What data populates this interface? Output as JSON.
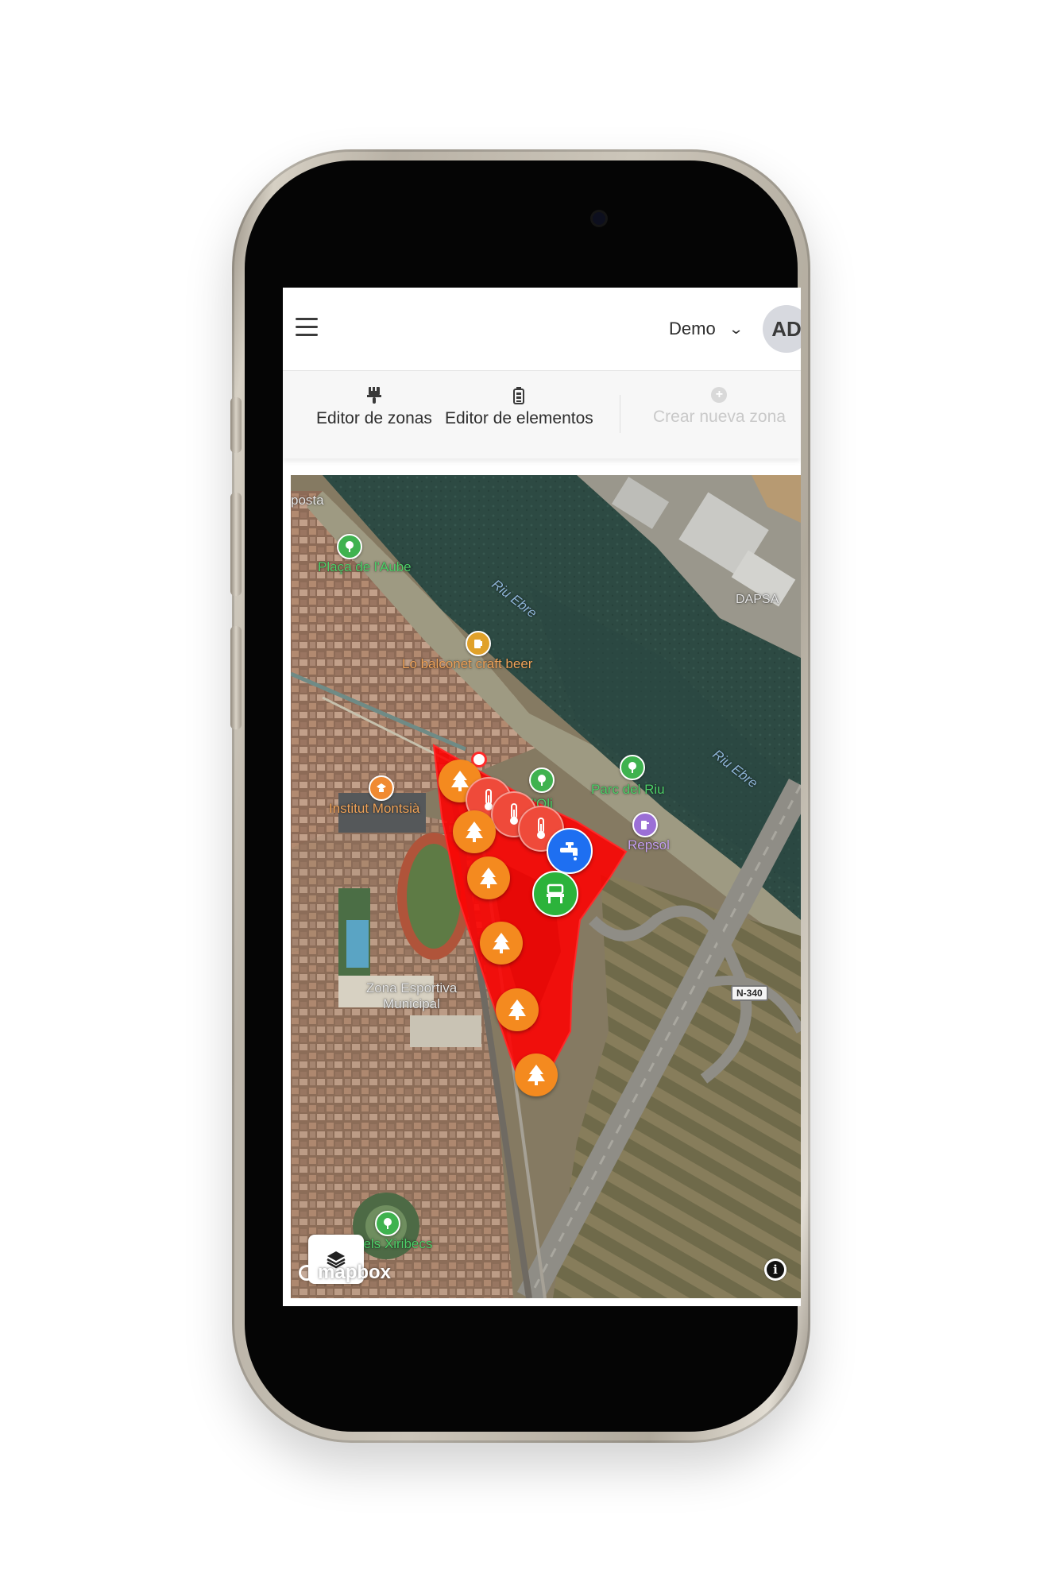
{
  "header": {
    "menu_icon": "hamburger-icon",
    "user_select_label": "Demo",
    "user_select_icon": "chevron-down-icon",
    "avatar_initials": "AD"
  },
  "toolbar": {
    "zone_editor_label": "Editor de zonas",
    "zone_editor_icon": "paint-brush-icon",
    "element_editor_label": "Editor de elementos",
    "element_editor_icon": "battery-icon",
    "create_zone_label": "Crear nueva zona",
    "create_zone_icon": "plus-circle-icon"
  },
  "map": {
    "labels": {
      "top_left_fragment": "posta",
      "placa": "Plaça de l'Aube",
      "river_1": "Riu Ebre",
      "river_2": "Riu Ebre",
      "dapsa": "DAPSA",
      "balconet": "Lo balconet craft beer",
      "parc_riu": "Parc del Riu",
      "oli": "l'Oli",
      "institut": "Institut Montsià",
      "repsol": "Repsol",
      "road_shield": "N-340",
      "zona_esportiva": "Zona Esportiva Municipal",
      "xiribecs": "dels Xiribecs"
    },
    "zone_color": "#ff0000",
    "marker_colors": {
      "tree": "#f48a1f",
      "thermometer": "#ef4a3a",
      "water_tap": "#1e6ff1",
      "bench": "#2cb33b"
    },
    "attribution": "mapbox",
    "layer_button_icon": "layers-icon",
    "info_button_icon": "info-icon"
  }
}
